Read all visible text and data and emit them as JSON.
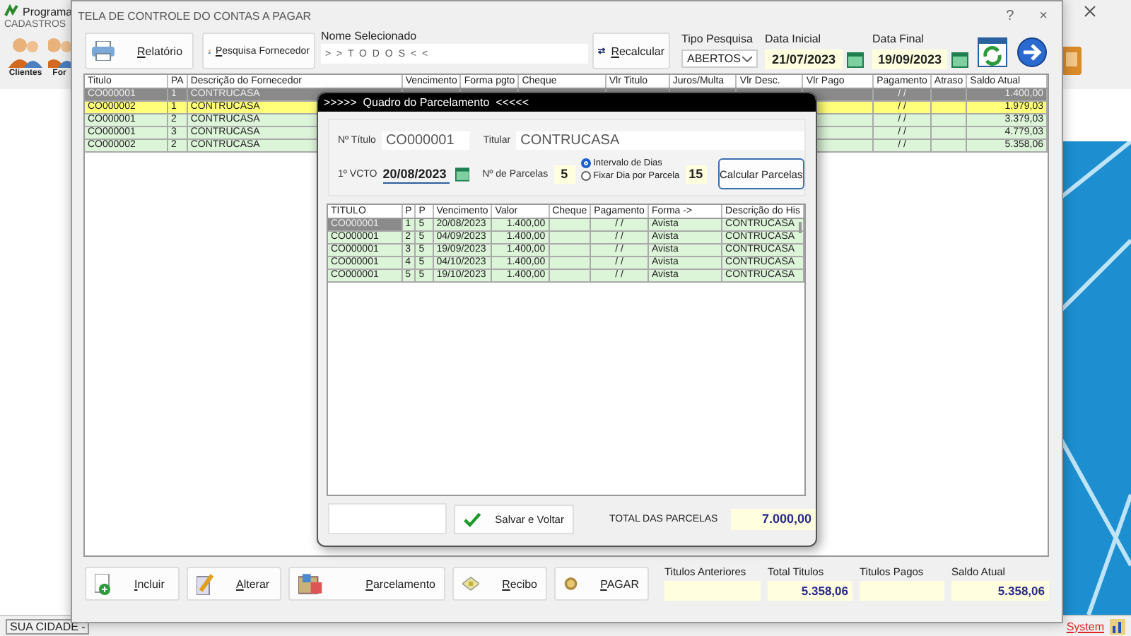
{
  "background_app": {
    "title": "Programa",
    "menu": [
      "CADASTROS"
    ],
    "toolbar": [
      {
        "label": "Clientes"
      },
      {
        "label": "For"
      }
    ],
    "status_bar": {
      "city": "SUA CIDADE -",
      "system": "System"
    }
  },
  "window": {
    "title": "TELA DE CONTROLE DO CONTAS A PAGAR",
    "help": "?",
    "close": "×"
  },
  "toolbar": {
    "report_button": "Relatório",
    "supplier_search_button": "Pesquisa Fornecedor",
    "selected_name": {
      "label": "Nome Selecionado",
      "value": "> > T O D O S < <"
    },
    "recalculate_button": "Recalcular",
    "search_type": {
      "label": "Tipo  Pesquisa",
      "value": "ABERTOS"
    },
    "start_date": {
      "label": "Data Inicial",
      "value": "21/07/2023"
    },
    "end_date": {
      "label": "Data Final",
      "value": "19/09/2023"
    }
  },
  "table": {
    "columns": [
      "Titulo",
      "PA",
      "Descrição do Fornecedor",
      "Vencimento",
      "Forma pgto",
      "Cheque",
      "Vlr Titulo",
      "Juros/Multa",
      "Vlr Desc.",
      "Vlr Pago",
      "Pagamento",
      "Atraso",
      "Saldo Atual"
    ],
    "rows": [
      {
        "titulo": "CO000001",
        "pa": "1",
        "descricao": "CONTRUCASA",
        "pagamento": "/ /",
        "saldo_atual": "1.400,00",
        "selected": true,
        "highlighted": false
      },
      {
        "titulo": "CO000002",
        "pa": "1",
        "descricao": "CONTRUCASA",
        "pagamento": "/ /",
        "saldo_atual": "1.979,03",
        "selected": false,
        "highlighted": true
      },
      {
        "titulo": "CO000001",
        "pa": "2",
        "descricao": "CONTRUCASA",
        "pagamento": "/ /",
        "saldo_atual": "3.379,03",
        "selected": false,
        "highlighted": false
      },
      {
        "titulo": "CO000001",
        "pa": "3",
        "descricao": "CONTRUCASA",
        "pagamento": "/ /",
        "saldo_atual": "4.779,03",
        "selected": false,
        "highlighted": false
      },
      {
        "titulo": "CO000002",
        "pa": "2",
        "descricao": "CONTRUCASA",
        "pagamento": "/ /",
        "saldo_atual": "5.358,06",
        "selected": false,
        "highlighted": false
      }
    ]
  },
  "footer": {
    "buttons": [
      "Incluir",
      "Alterar",
      "Parcelamento",
      "Recibo",
      "PAGAR"
    ],
    "totals": [
      {
        "label": "Titulos Anteriores"
      },
      {
        "label": "Total Titulos",
        "value": "5.358,06"
      },
      {
        "label": "Titulos Pagos"
      },
      {
        "label": "Saldo Atual",
        "value": "5.358,06"
      }
    ]
  },
  "dialog": {
    "title": ">>>>>  Quadro do Parcelamento  <<<<<",
    "titulo": {
      "label": "Nº Título",
      "value": "CO000001"
    },
    "titular": {
      "label": "Titular",
      "value": "CONTRUCASA"
    },
    "first_due": {
      "label": "1º VCTO",
      "value": "20/08/2023"
    },
    "installments": {
      "label": "Nº de Parcelas",
      "value": "5"
    },
    "interval_options": [
      {
        "label": "Intervalo de Dias",
        "selected": true
      },
      {
        "label": "Fixar Dia por Parcela",
        "selected": false
      }
    ],
    "interval_value": "15",
    "calculate_button": "Calcular Parcelas",
    "table": {
      "columns": [
        "TITULO",
        "P",
        "P",
        "Vencimento",
        "Valor",
        "Cheque",
        "Pagamento",
        "Forma ->",
        "Descrição do His"
      ],
      "rows": [
        {
          "titulo": "CO000001",
          "parcela": "1",
          "parcelas": "5",
          "vencimento": "20/08/2023",
          "valor": "1.400,00",
          "pagamento": "/ /",
          "forma": "Avista",
          "descricao": "CONTRUCASA",
          "selected": true
        },
        {
          "titulo": "CO000001",
          "parcela": "2",
          "parcelas": "5",
          "vencimento": "04/09/2023",
          "valor": "1.400,00",
          "pagamento": "/ /",
          "forma": "Avista",
          "descricao": "CONTRUCASA",
          "selected": false
        },
        {
          "titulo": "CO000001",
          "parcela": "3",
          "parcelas": "5",
          "vencimento": "19/09/2023",
          "valor": "1.400,00",
          "pagamento": "/ /",
          "forma": "Avista",
          "descricao": "CONTRUCASA",
          "selected": false
        },
        {
          "titulo": "CO000001",
          "parcela": "4",
          "parcelas": "5",
          "vencimento": "04/10/2023",
          "valor": "1.400,00",
          "pagamento": "/ /",
          "forma": "Avista",
          "descricao": "CONTRUCASA",
          "selected": false
        },
        {
          "titulo": "CO000001",
          "parcela": "5",
          "parcelas": "5",
          "vencimento": "19/10/2023",
          "valor": "1.400,00",
          "pagamento": "/ /",
          "forma": "Avista",
          "descricao": "CONTRUCASA",
          "selected": false
        }
      ]
    },
    "save_button": "Salvar e Voltar",
    "total": {
      "label": "TOTAL DAS PARCELAS",
      "value": "7.000,00"
    }
  }
}
